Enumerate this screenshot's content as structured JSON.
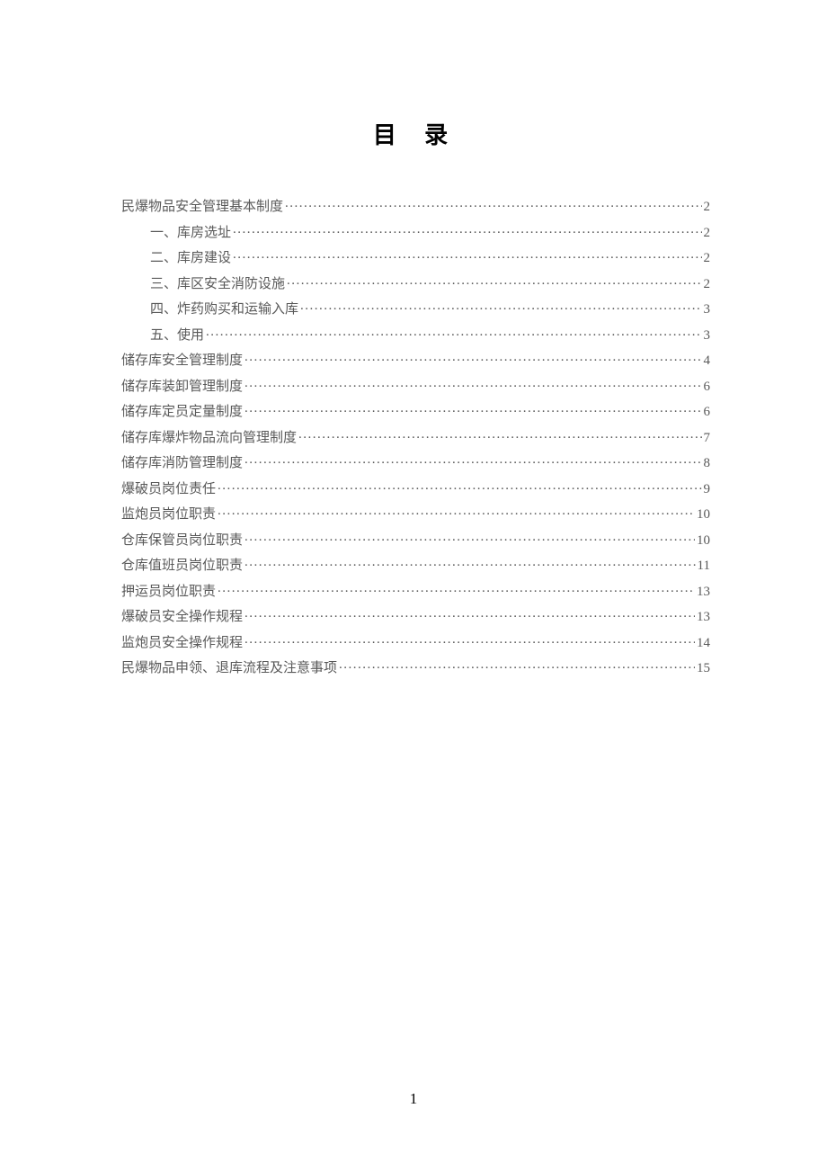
{
  "title": "目 录",
  "page_number": "1",
  "toc": [
    {
      "level": 1,
      "label": "民爆物品安全管理基本制度",
      "page": "2"
    },
    {
      "level": 2,
      "label": "一、库房选址",
      "page": "2"
    },
    {
      "level": 2,
      "label": "二、库房建设",
      "page": "2"
    },
    {
      "level": 2,
      "label": "三、库区安全消防设施",
      "page": "2"
    },
    {
      "level": 2,
      "label": "四、炸药购买和运输入库",
      "page": "3"
    },
    {
      "level": 2,
      "label": "五、使用",
      "page": "3"
    },
    {
      "level": 1,
      "label": "储存库安全管理制度",
      "page": "4"
    },
    {
      "level": 1,
      "label": "储存库装卸管理制度",
      "page": "6"
    },
    {
      "level": 1,
      "label": "储存库定员定量制度",
      "page": "6"
    },
    {
      "level": 1,
      "label": "储存库爆炸物品流向管理制度",
      "page": "7"
    },
    {
      "level": 1,
      "label": "储存库消防管理制度",
      "page": "8"
    },
    {
      "level": 1,
      "label": "爆破员岗位责任",
      "page": "9"
    },
    {
      "level": 1,
      "label": "监炮员岗位职责",
      "page": "10"
    },
    {
      "level": 1,
      "label": "仓库保管员岗位职责",
      "page": "10"
    },
    {
      "level": 1,
      "label": "仓库值班员岗位职责",
      "page": "11"
    },
    {
      "level": 1,
      "label": "押运员岗位职责",
      "page": "13"
    },
    {
      "level": 1,
      "label": "爆破员安全操作规程",
      "page": "13"
    },
    {
      "level": 1,
      "label": "监炮员安全操作规程",
      "page": "14"
    },
    {
      "level": 1,
      "label": "民爆物品申领、退库流程及注意事项",
      "page": "15"
    }
  ]
}
